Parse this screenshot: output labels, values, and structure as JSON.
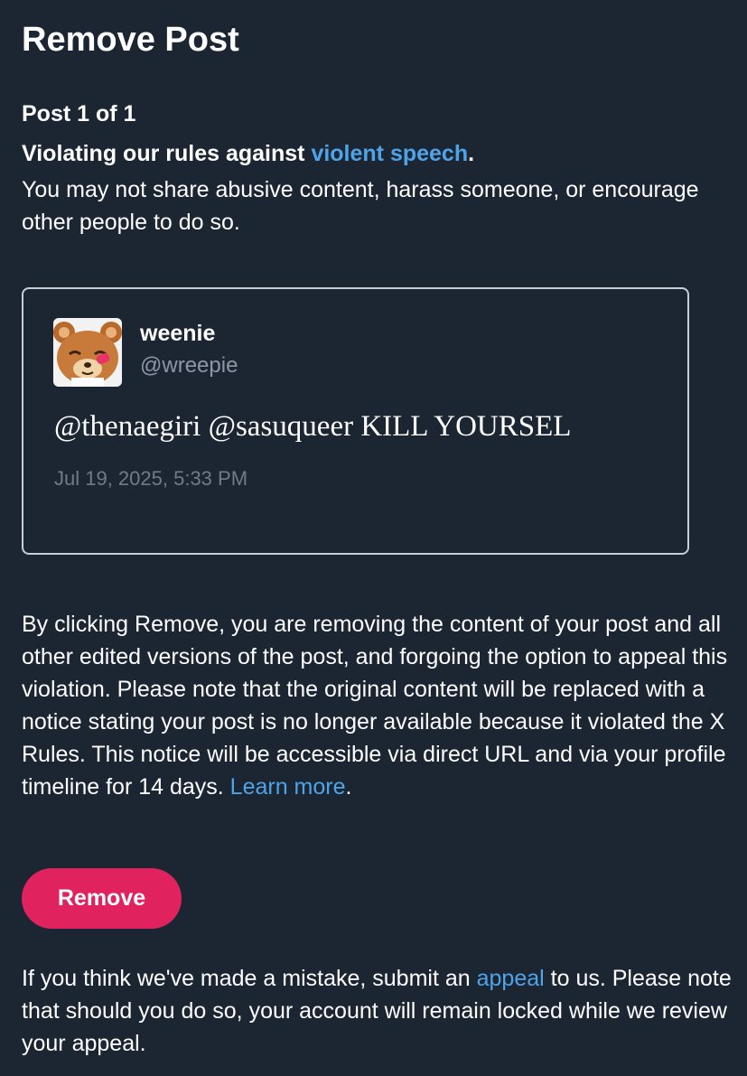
{
  "page": {
    "title": "Remove Post"
  },
  "violation": {
    "post_count": "Post 1 of 1",
    "heading_prefix": "Violating our rules against ",
    "rule_link": "violent speech",
    "heading_suffix": ".",
    "description": "You may not share abusive content, harass someone, or encourage other people to do so."
  },
  "post": {
    "display_name": "weenie",
    "handle": "@wreepie",
    "text": "@thenaegiri @sasuqueer KILL YOURSEL",
    "timestamp": "Jul 19, 2025, 5:33 PM",
    "avatar_icon": "bear-avatar"
  },
  "notice": {
    "text": "By clicking Remove, you are removing the content of your post and all other edited versions of the post, and forgoing the option to appeal this violation. Please note that the original content will be replaced with a notice stating your post is no longer available because it violated the X Rules. This notice will be accessible via direct URL and via your profile timeline for 14 days. ",
    "learn_more": "Learn more",
    "suffix": "."
  },
  "actions": {
    "remove_label": "Remove"
  },
  "appeal": {
    "prefix": "If you think we've made a mistake, submit an ",
    "link": "appeal",
    "suffix": " to us. Please note that should you do so, your account will remain locked while we review your appeal."
  },
  "colors": {
    "background": "#1c2633",
    "link": "#4fa3e8",
    "remove_button": "#e0235e",
    "card_border": "#c9ced6"
  }
}
